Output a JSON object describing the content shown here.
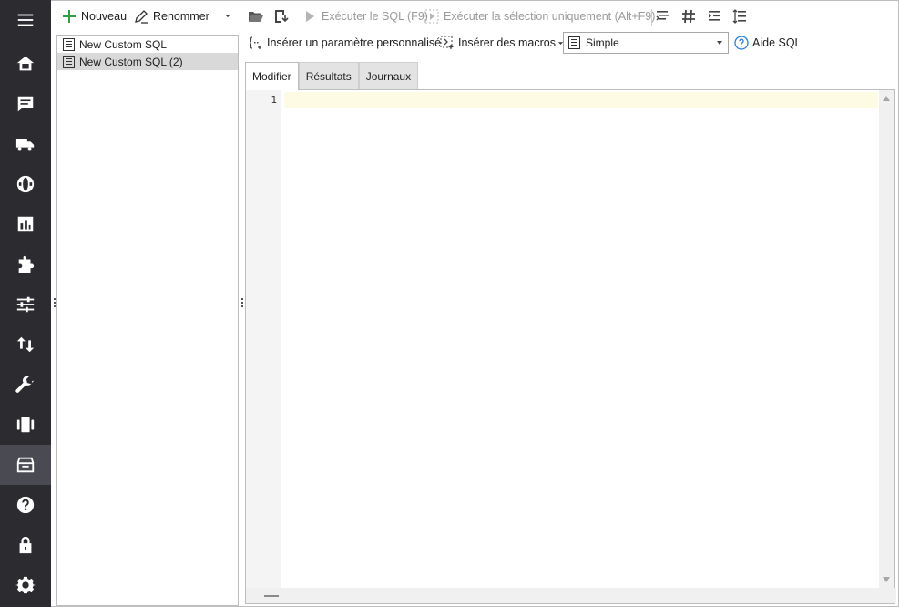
{
  "rail": {
    "items": [
      {
        "icon": "menu-icon"
      },
      {
        "icon": "home-icon"
      },
      {
        "icon": "chat-icon"
      },
      {
        "icon": "truck-icon"
      },
      {
        "icon": "globe-icon"
      },
      {
        "icon": "chart-icon"
      },
      {
        "icon": "puzzle-icon"
      },
      {
        "icon": "sliders-icon"
      },
      {
        "icon": "transfer-icon"
      },
      {
        "icon": "wrench-icon"
      },
      {
        "icon": "film-icon"
      },
      {
        "icon": "archive-icon",
        "active": true
      },
      {
        "icon": "help-icon"
      },
      {
        "icon": "lock-icon"
      },
      {
        "icon": "gear-icon"
      }
    ]
  },
  "toolbar": {
    "new_label": "Nouveau",
    "rename_label": "Renommer",
    "run_sql_label": "Exécuter le SQL (F9)",
    "run_selection_label": "Exécuter la sélection uniquement (Alt+F9)"
  },
  "queries": [
    {
      "name": "New Custom SQL",
      "selected": false
    },
    {
      "name": "New Custom SQL (2)",
      "selected": true
    }
  ],
  "subbar": {
    "insert_param_label": "Insérer un paramètre personnalisé",
    "insert_macros_label": "Insérer des macros",
    "mode_value": "Simple",
    "help_label": "Aide SQL"
  },
  "tabs": [
    {
      "label": "Modifier",
      "active": true
    },
    {
      "label": "Résultats",
      "active": false
    },
    {
      "label": "Journaux",
      "active": false
    }
  ],
  "editor": {
    "line_number": "1"
  },
  "colors": {
    "rail_bg": "#2b2b30",
    "rail_active": "#4a4a52",
    "accent_green": "#2e9e3e",
    "help_blue": "#2a7fd6",
    "current_line": "#fdfbe3"
  }
}
